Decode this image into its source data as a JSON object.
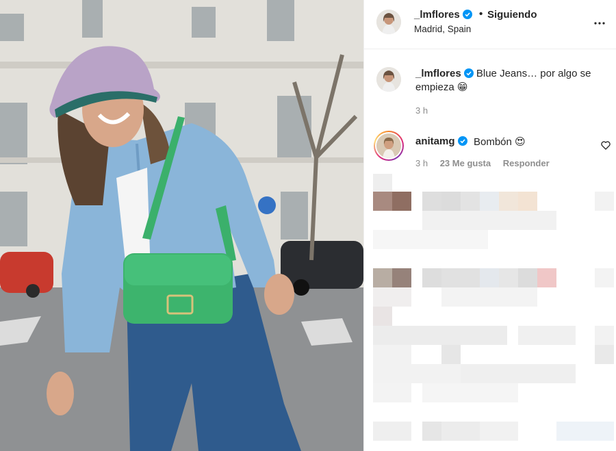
{
  "post": {
    "username": "_lmflores",
    "verified": true,
    "separator": "•",
    "follow_state": "Siguiendo",
    "location": "Madrid, Spain"
  },
  "caption": {
    "username": "_lmflores",
    "text": "Blue Jeans… por algo se empieza 😁",
    "time": "3 h"
  },
  "comments": [
    {
      "username": "anitamg",
      "verified": true,
      "text": "Bombón 😍",
      "time": "3 h",
      "likes": "23 Me gusta",
      "reply_label": "Responder"
    }
  ],
  "icons": {
    "verified": "verified-badge-icon",
    "more": "more-options-icon",
    "like": "heart-icon"
  },
  "colors": {
    "verified_blue": "#0095f6",
    "secondary_text": "#8e8e8e",
    "primary_text": "#262626",
    "story_ring_start": "#f58529",
    "story_ring_mid": "#dd2a7b"
  }
}
